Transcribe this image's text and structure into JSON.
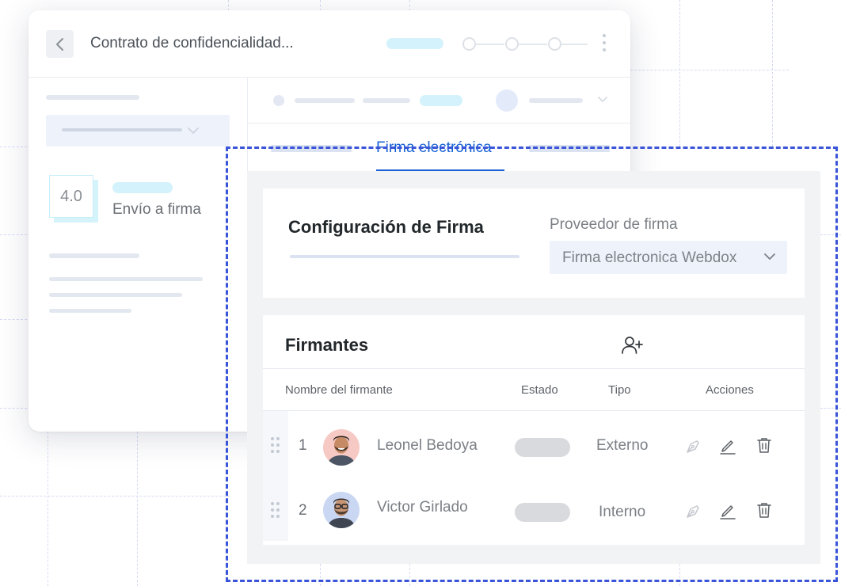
{
  "document": {
    "title": "Contrato de confidencialidad...",
    "version": "4.0",
    "sidebar_label": "Envío a firma"
  },
  "tabs": {
    "active_label": "Firma electrónica"
  },
  "config": {
    "title": "Configuración de Firma",
    "provider_label": "Proveedor de firma",
    "provider_value": "Firma electronica Webdox"
  },
  "signers": {
    "title": "Firmantes",
    "columns": [
      "Nombre del firmante",
      "Estado",
      "Tipo",
      "Acciones"
    ],
    "rows": [
      {
        "number": "1",
        "name": "Leonel Bedoya",
        "type": "Externo",
        "avatar_bg": "#f6c9c4"
      },
      {
        "number": "2",
        "name": "Victor Girlado",
        "type": "Interno",
        "avatar_bg": "#c9d7f3"
      }
    ]
  },
  "icons": {
    "back": "chevron-left-icon",
    "menu": "kebab-icon",
    "dropdown": "chevron-down-icon",
    "add_signer": "add-user-icon",
    "drag": "drag-handle-icon",
    "sign": "pen-nib-icon",
    "edit": "pencil-icon",
    "delete": "trash-icon"
  },
  "colors": {
    "accent": "#1761d4",
    "selection": "#3b55d9",
    "skeleton_cyan": "#d3f2fb"
  }
}
